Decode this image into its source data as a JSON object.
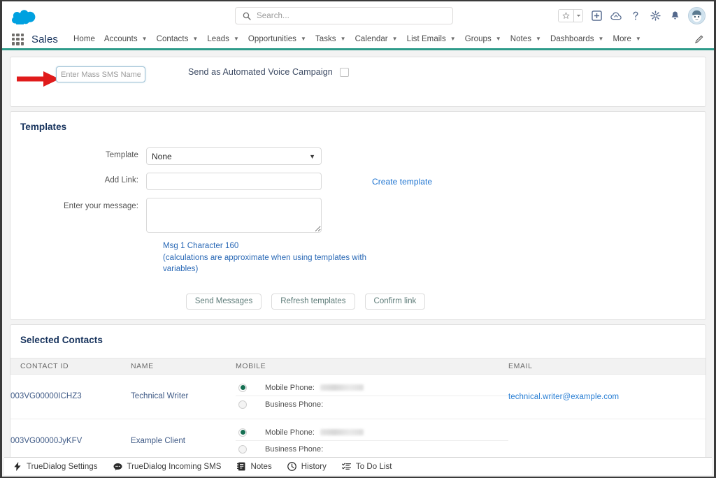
{
  "header": {
    "logo": "salesforce-cloud-logo",
    "search": {
      "placeholder": "Search...",
      "value": "",
      "icon": "search-icon"
    },
    "icons": [
      {
        "name": "favorites-star-icon",
        "glyph": "★"
      },
      {
        "name": "favorites-caret-icon",
        "glyph": "▾"
      },
      {
        "name": "add-plus-icon",
        "glyph": "+"
      },
      {
        "name": "cloud-setup-icon",
        "glyph": "☁"
      },
      {
        "name": "help-icon",
        "glyph": "?"
      },
      {
        "name": "settings-gear-icon",
        "glyph": "⚙"
      },
      {
        "name": "notifications-bell-icon",
        "glyph": "🔔"
      },
      {
        "name": "user-avatar",
        "glyph": ""
      }
    ]
  },
  "nav": {
    "app_launcher_icon": "app-launcher-waffle-icon",
    "app_name": "Sales",
    "items": [
      {
        "label": "Home",
        "caret": false
      },
      {
        "label": "Accounts",
        "caret": true
      },
      {
        "label": "Contacts",
        "caret": true
      },
      {
        "label": "Leads",
        "caret": true
      },
      {
        "label": "Opportunities",
        "caret": true
      },
      {
        "label": "Tasks",
        "caret": true
      },
      {
        "label": "Calendar",
        "caret": true
      },
      {
        "label": "List Emails",
        "caret": true
      },
      {
        "label": "Groups",
        "caret": true
      },
      {
        "label": "Notes",
        "caret": true
      },
      {
        "label": "Dashboards",
        "caret": true
      },
      {
        "label": "More",
        "caret": true
      }
    ],
    "edit_icon": "pencil-edit-icon",
    "accent_color": "#2e9b8a"
  },
  "name_card": {
    "mass_sms_name": {
      "placeholder": "Enter Mass SMS Name",
      "value": ""
    },
    "voice_campaign_label": "Send as Automated Voice Campaign",
    "voice_campaign_checked": false,
    "annotation": {
      "name": "red-arrow-annotation",
      "color": "#e01b1b"
    }
  },
  "templates": {
    "title": "Templates",
    "template_label": "Template",
    "template_value": "None",
    "template_options": [
      "None"
    ],
    "add_link_label": "Add Link:",
    "add_link_value": "",
    "message_label": "Enter your message:",
    "message_value": "",
    "create_template_link": "Create template",
    "char_note_line1": "Msg 1 Character 160",
    "char_note_line2": "(calculations are approximate when using templates with variables)",
    "buttons": [
      {
        "label": "Send Messages",
        "name": "send-messages-button"
      },
      {
        "label": "Refresh templates",
        "name": "refresh-templates-button"
      },
      {
        "label": "Confirm link",
        "name": "confirm-link-button"
      }
    ]
  },
  "contacts": {
    "title": "Selected Contacts",
    "columns": [
      "CONTACT ID",
      "NAME",
      "MOBILE",
      "EMAIL"
    ],
    "rows": [
      {
        "contact_id": "003VG00000ICHZ3",
        "name": "Technical Writer",
        "mobile_label": "Mobile Phone:",
        "mobile_value": "",
        "mobile_selected": true,
        "business_label": "Business Phone:",
        "business_value": "",
        "business_selected": false,
        "email": "technical.writer@example.com"
      },
      {
        "contact_id": "003VG00000JyKFV",
        "name": "Example Client",
        "mobile_label": "Mobile Phone:",
        "mobile_value": "",
        "mobile_selected": true,
        "business_label": "Business Phone:",
        "business_value": "",
        "business_selected": false,
        "email": ""
      }
    ]
  },
  "utility_bar": {
    "items": [
      {
        "label": "TrueDialog Settings",
        "icon": "lightning-bolt-icon"
      },
      {
        "label": "TrueDialog Incoming SMS",
        "icon": "chat-bubble-icon"
      },
      {
        "label": "Notes",
        "icon": "notes-book-icon"
      },
      {
        "label": "History",
        "icon": "clock-icon"
      },
      {
        "label": "To Do List",
        "icon": "checklist-icon"
      }
    ]
  }
}
